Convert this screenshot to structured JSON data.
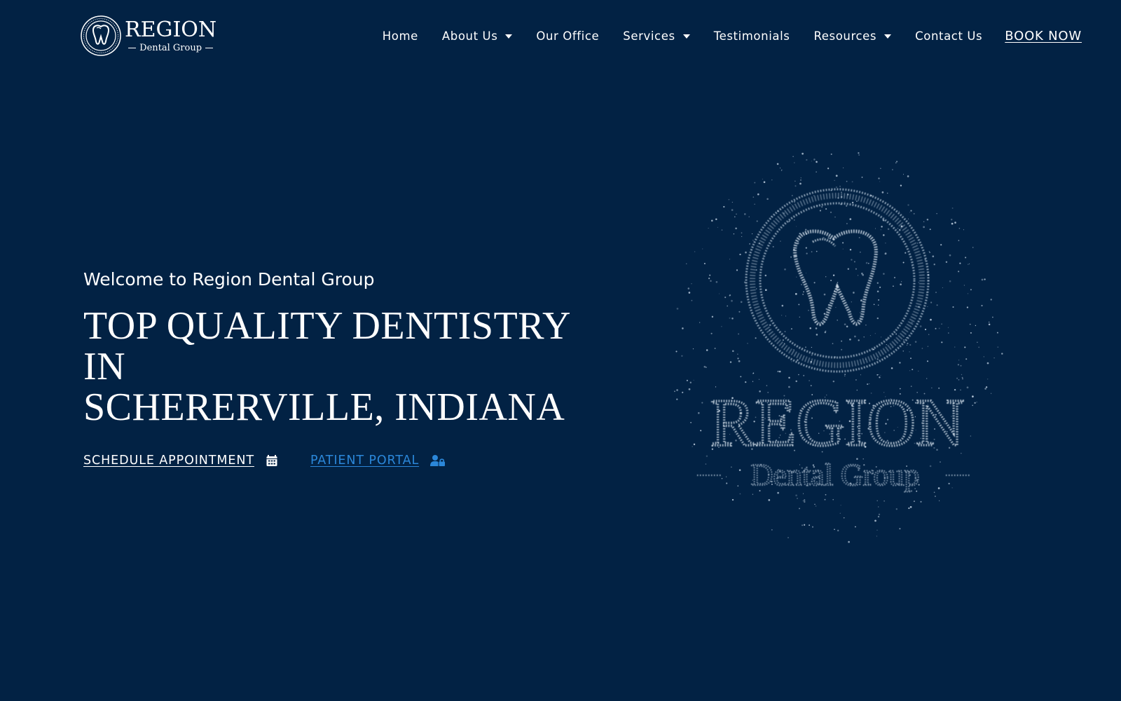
{
  "brand": {
    "name": "REGION",
    "tagline": "Dental Group",
    "logo_icon": "tooth-emblem-icon"
  },
  "nav": {
    "items": [
      {
        "label": "Home",
        "has_dropdown": false
      },
      {
        "label": "About Us",
        "has_dropdown": true
      },
      {
        "label": "Our Office",
        "has_dropdown": false
      },
      {
        "label": "Services",
        "has_dropdown": true
      },
      {
        "label": "Testimonials",
        "has_dropdown": false
      },
      {
        "label": "Resources",
        "has_dropdown": true
      },
      {
        "label": "Contact Us",
        "has_dropdown": false
      }
    ],
    "book_now": "BOOK NOW"
  },
  "hero": {
    "welcome": "Welcome to Region Dental Group",
    "headline_line1": "TOP QUALITY DENTISTRY IN",
    "headline_line2": "SCHERERVILLE, INDIANA",
    "schedule_label": "SCHEDULE APPOINTMENT",
    "schedule_icon": "calendar-icon",
    "portal_label": "PATIENT PORTAL",
    "portal_icon": "user-lock-icon"
  },
  "particle_logo": {
    "word": "REGION",
    "tagline": "Dental Group"
  },
  "colors": {
    "background": "#022244",
    "text": "#ffffff",
    "link_accent": "#2b87d9",
    "particle": "#c8d8e8"
  }
}
